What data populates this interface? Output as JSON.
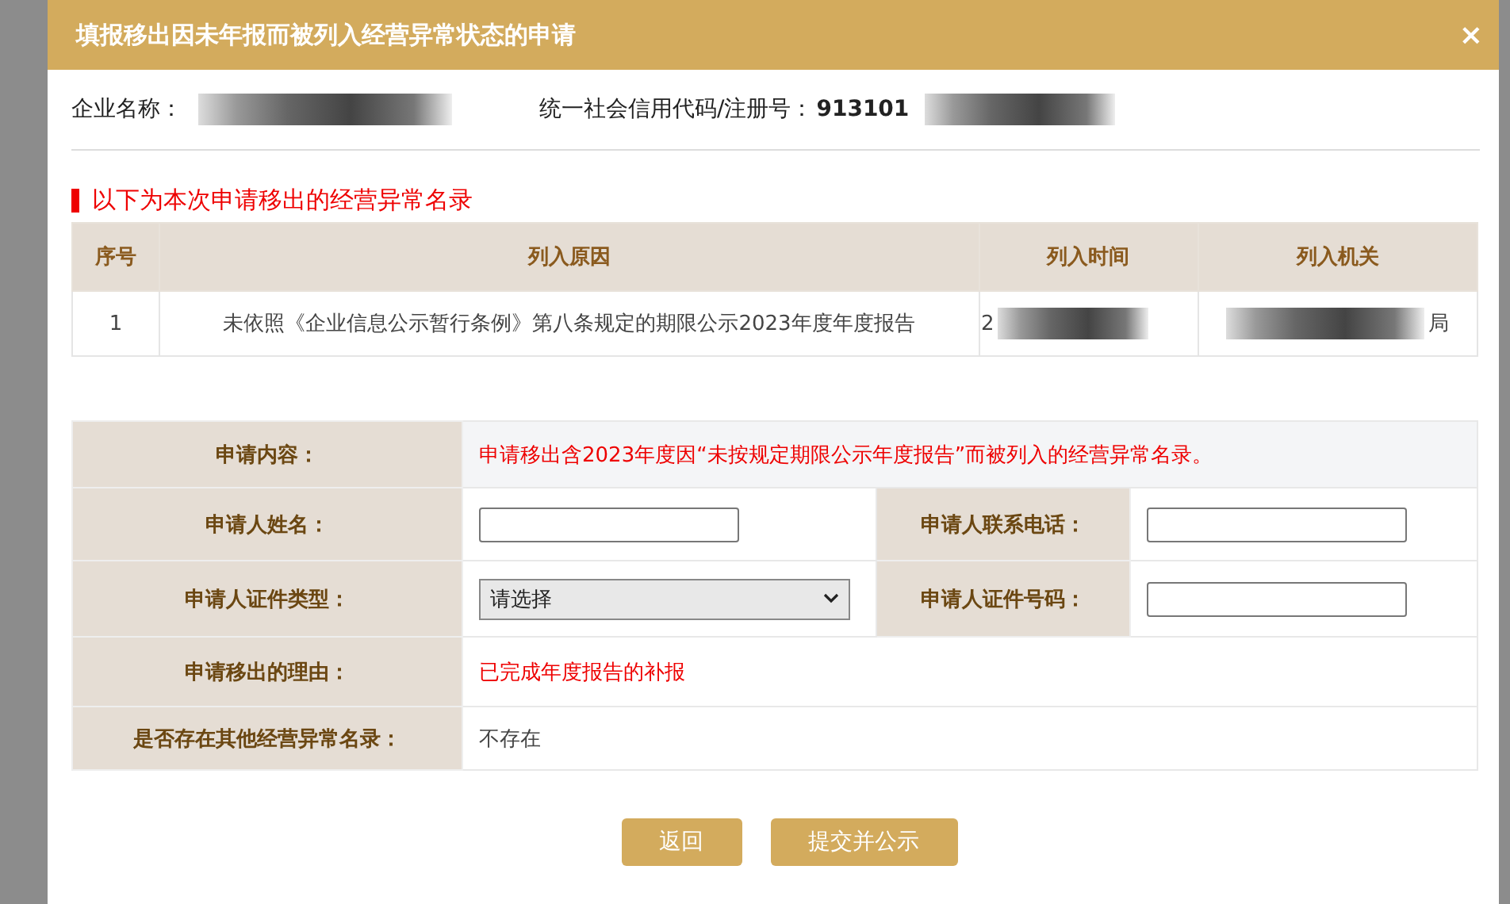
{
  "dialog": {
    "title": "填报移出因未年报而被列入经营异常状态的申请",
    "close": "×"
  },
  "company": {
    "name_label": "企业名称：",
    "code_label": "统一社会信用代码/注册号：",
    "code_value": "913101"
  },
  "section_title": "以下为本次申请移出的经营异常名录",
  "list_table": {
    "columns": [
      "序号",
      "列入原因",
      "列入时间",
      "列入机关"
    ],
    "rows": [
      {
        "index": "1",
        "reason": "未依照《企业信息公示暂行条例》第八条规定的期限公示2023年度年度报告",
        "date": "2",
        "authority": "局"
      }
    ]
  },
  "form": {
    "content_label": "申请内容：",
    "content_value": "申请移出含2023年度因“未按规定期限公示年度报告”而被列入的经营异常名录。",
    "name_label": "申请人姓名：",
    "phone_label": "申请人联系电话：",
    "id_type_label": "申请人证件类型：",
    "id_type_value": "请选择",
    "id_number_label": "申请人证件号码：",
    "reason_label": "申请移出的理由：",
    "reason_value": "已完成年度报告的补报",
    "other_label": "是否存在其他经营异常名录：",
    "other_value": "不存在"
  },
  "buttons": [
    "返回",
    "提交并公示"
  ]
}
